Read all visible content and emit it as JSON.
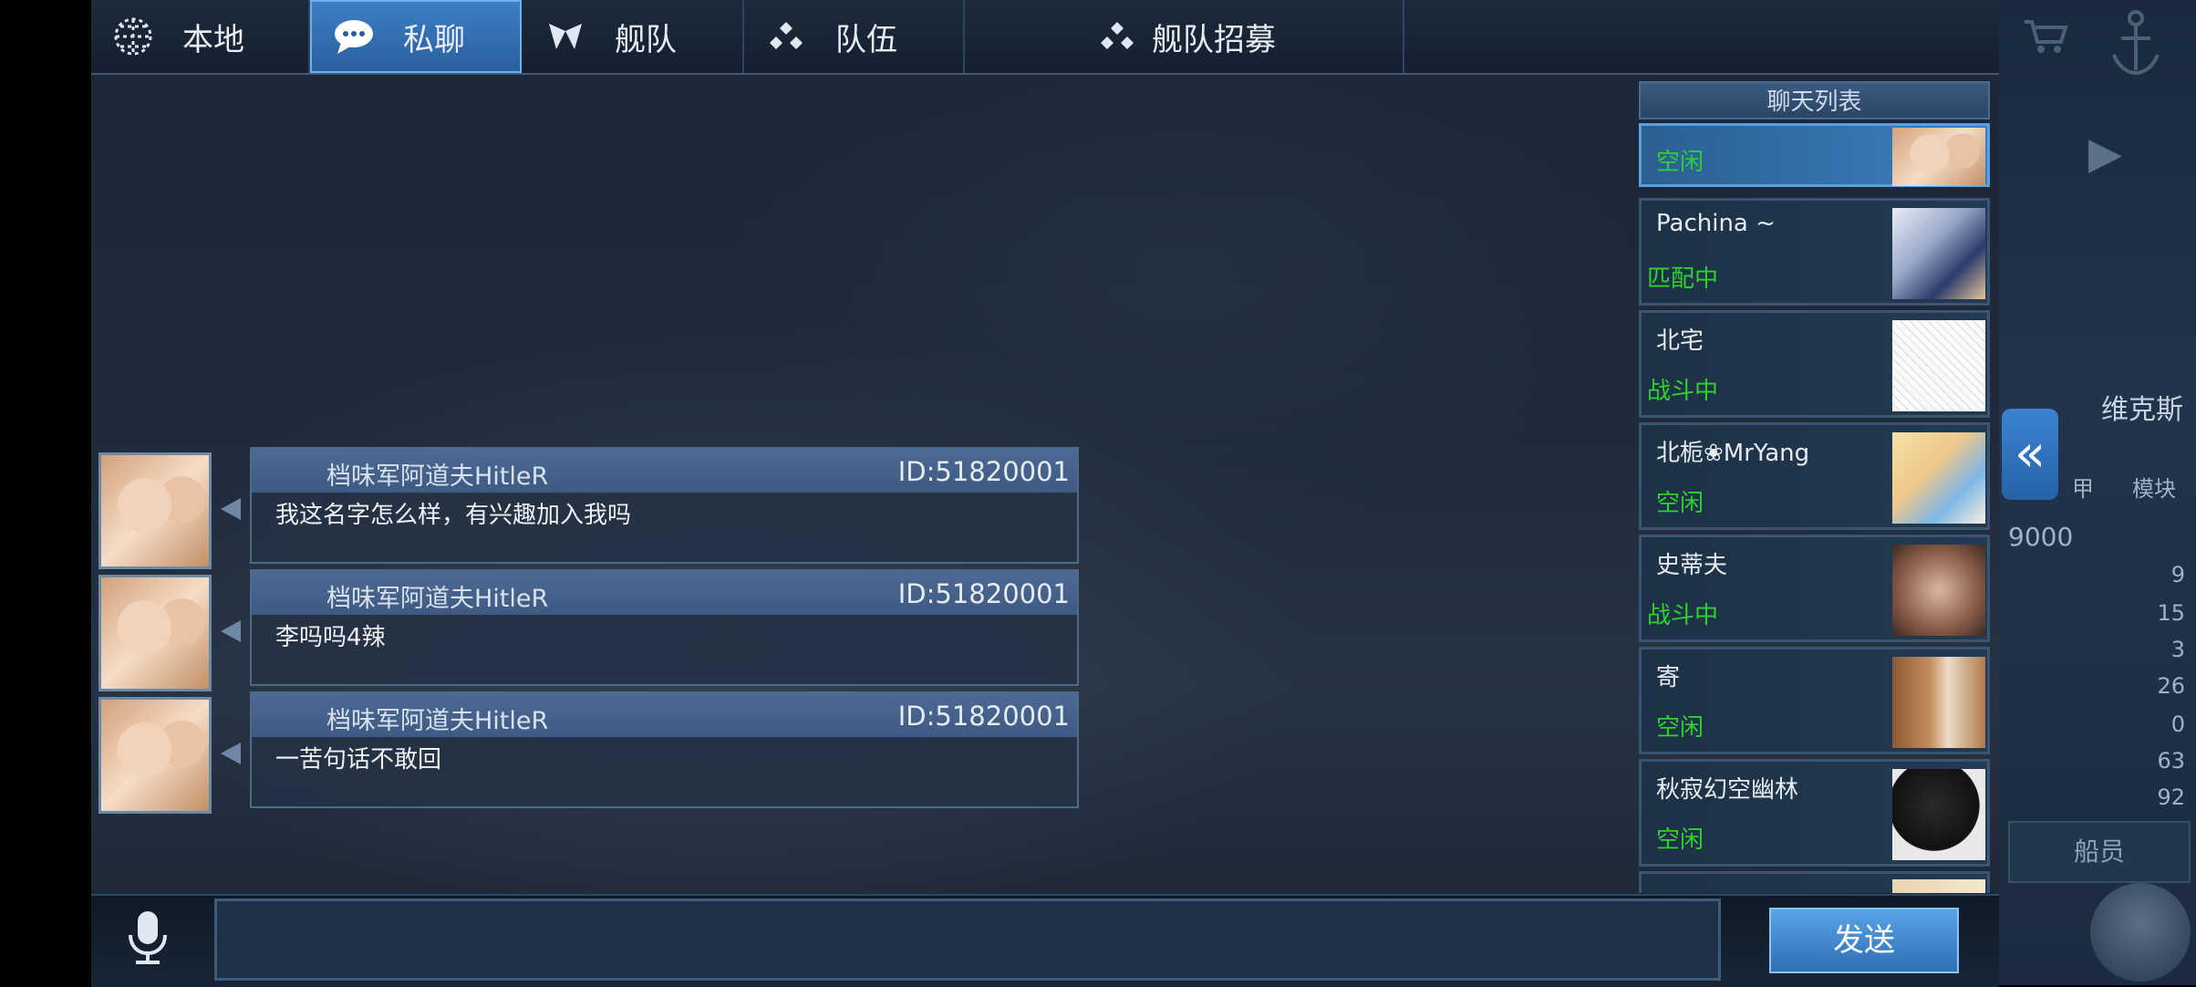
{
  "tabs": [
    {
      "label": "本地",
      "icon": "globe-icon"
    },
    {
      "label": "私聊",
      "icon": "chat-bubble-icon"
    },
    {
      "label": "舰队",
      "icon": "fleet-icon"
    },
    {
      "label": "队伍",
      "icon": "team-icon"
    },
    {
      "label": "舰队招募",
      "icon": "recruit-icon"
    }
  ],
  "chat_list": {
    "title": "聊天列表",
    "contacts": [
      {
        "name": "",
        "status": "空闲",
        "status_color": "#2fd12f"
      },
      {
        "name": "Pachina ~",
        "status": "匹配中",
        "status_color": "#2fd12f"
      },
      {
        "name": "北宅",
        "status": "战斗中",
        "status_color": "#2fd12f"
      },
      {
        "name": "北栀❀MrYang",
        "status": "空闲",
        "status_color": "#2fd12f"
      },
      {
        "name": "史蒂夫",
        "status": "战斗中",
        "status_color": "#2fd12f"
      },
      {
        "name": "寄",
        "status": "空闲",
        "status_color": "#2fd12f"
      },
      {
        "name": "秋寂幻空幽林",
        "status": "空闲",
        "status_color": "#2fd12f"
      }
    ]
  },
  "messages": [
    {
      "sender": "档味军阿道夫HitleR",
      "id": "ID:51820001",
      "text": "我这名字怎么样，有兴趣加入我吗"
    },
    {
      "sender": "档味军阿道夫HitleR",
      "id": "ID:51820001",
      "text": "李吗吗4辣"
    },
    {
      "sender": "档味军阿道夫HitleR",
      "id": "ID:51820001",
      "text": "一苦句话不敢回"
    }
  ],
  "input": {
    "value": "",
    "placeholder": ""
  },
  "send_label": "发送",
  "right_panel": {
    "ship_partial": "维克斯",
    "label_a": "甲",
    "label_b": "模块",
    "value_main": "9000",
    "stats": [
      "9",
      "15",
      "3",
      "26",
      "0",
      "63",
      "92"
    ],
    "crew_label": "船员"
  }
}
